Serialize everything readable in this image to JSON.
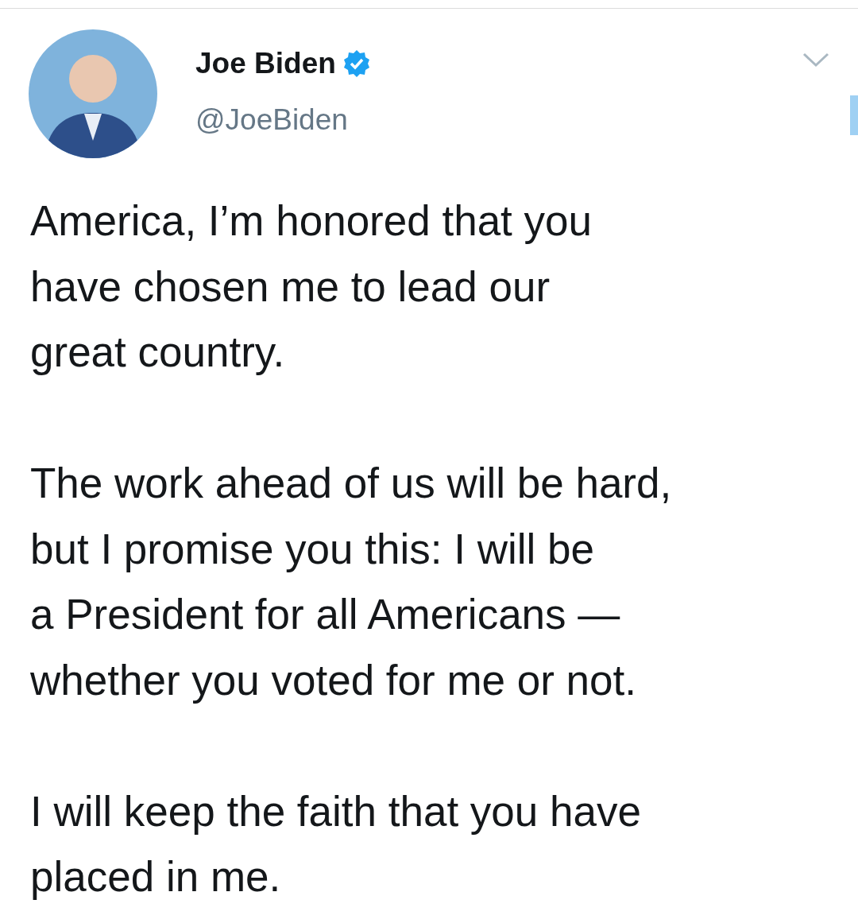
{
  "author": {
    "name": "Joe Biden",
    "verified": true,
    "handle": "@JoeBiden"
  },
  "tweet": {
    "paragraphs": [
      [
        "America, I’m honored that you",
        "have chosen me to lead our",
        "great country."
      ],
      [
        "The work ahead of us will be hard,",
        "but I promise you this: I will be",
        "a President for all Americans —",
        "whether you voted for me or not."
      ],
      [
        "I will keep the faith that you have",
        "placed in me."
      ]
    ]
  }
}
